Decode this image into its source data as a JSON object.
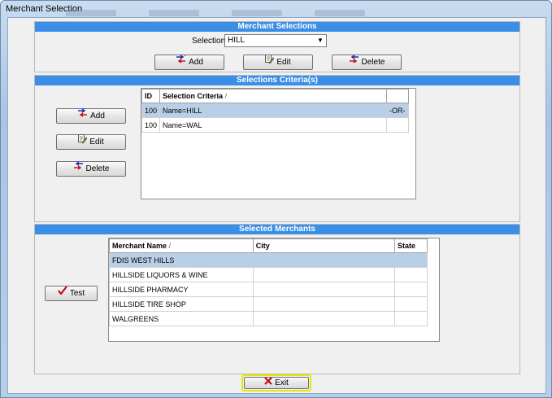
{
  "window": {
    "title": "Merchant Selection"
  },
  "merchant_selections": {
    "header": "Merchant Selections",
    "selections_label": "Selections",
    "selected_value": "HILL",
    "add_label": "Add",
    "edit_label": "Edit",
    "delete_label": "Delete"
  },
  "criteria": {
    "header": "Selections Criteria(s)",
    "add_label": "Add",
    "edit_label": "Edit",
    "delete_label": "Delete",
    "columns": {
      "id": "ID",
      "criteria": "Selection Criteria",
      "sort": "/"
    },
    "rows": [
      {
        "id": "100",
        "criteria": "Name=HILL",
        "op": "-OR-"
      },
      {
        "id": "100",
        "criteria": "Name=WAL",
        "op": ""
      }
    ]
  },
  "merchants": {
    "header": "Selected Merchants",
    "test_label": "Test",
    "columns": {
      "name": "Merchant Name",
      "sort": "/",
      "city": "City",
      "state": "State"
    },
    "rows": [
      {
        "name": "FDIS WEST HILLS",
        "city": "",
        "state": ""
      },
      {
        "name": "HILLSIDE LIQUORS & WINE",
        "city": "",
        "state": ""
      },
      {
        "name": "HILLSIDE PHARMACY",
        "city": "",
        "state": ""
      },
      {
        "name": "HILLSIDE TIRE SHOP",
        "city": "",
        "state": ""
      },
      {
        "name": "WALGREENS",
        "city": "",
        "state": ""
      }
    ]
  },
  "footer": {
    "exit_label": "Exit"
  },
  "colors": {
    "header_blue": "#3a8ee6",
    "selected_row": "#b8cfe8",
    "exit_highlight": "#e8e800"
  }
}
